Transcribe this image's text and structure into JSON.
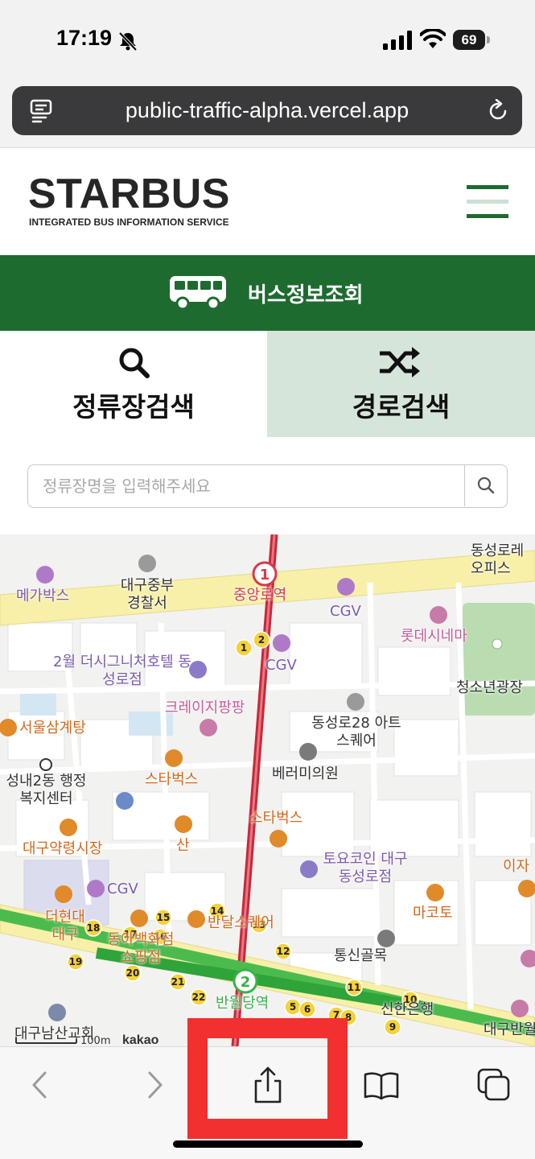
{
  "status_bar": {
    "time": "17:19",
    "battery": "69"
  },
  "browser": {
    "url": "public-traffic-alpha.vercel.app"
  },
  "site": {
    "logo": "STARBUS",
    "logo_subtitle": "INTEGRATED BUS INFORMATION SERVICE",
    "banner_title": "버스정보조회",
    "brand_color": "#1e6b30",
    "tabs": [
      {
        "label": "정류장검색",
        "icon": "search-icon",
        "selected": true
      },
      {
        "label": "경로검색",
        "icon": "shuffle-icon",
        "selected": false
      }
    ],
    "search": {
      "placeholder": "정류장명을 입력해주세요",
      "value": ""
    }
  },
  "map": {
    "labels": {
      "mega": "메가박스",
      "police": "대구중부 경찰서",
      "jungangro": "중앙로역",
      "cgv1": "CGV",
      "cgv2": "CGV",
      "cgv3": "CGV",
      "lotte": "롯데시네마",
      "dongseong_office": "동성로레 오피스",
      "hotel": "2월 더시그니처호텔 동성로점",
      "crazy": "크레이지팡팡",
      "youth_square": "청소년광장",
      "samgyetang": "서울삼계탕",
      "art_square": "동성로28 아트 스퀘어",
      "seongnae": "성내2동 행정복지센터",
      "starbucks1": "스타벅스",
      "clinic": "베러미의원",
      "starbucks2": "스타벅스",
      "san": "산",
      "medicine_market": "대구약령시장",
      "toyoko": "토요코인 대구동성로점",
      "hyundai": "더현대 대구",
      "dongah": "동아백화점 쇼핑점",
      "bandal": "반달스퀘어",
      "makoto": "마코토",
      "izakaya": "이자",
      "tongsin": "통신골목",
      "banwoldang": "반월당역",
      "shinhan": "신한은행",
      "namsan_church": "대구남산교회",
      "banwol_right": "대구반월",
      "kakao": "kakao",
      "scale": "100m"
    },
    "subway_stops": [
      "1",
      "2"
    ],
    "bus_stops": [
      "1",
      "2",
      "5",
      "6",
      "7",
      "8",
      "9",
      "10",
      "11",
      "12",
      "13",
      "14",
      "15",
      "16",
      "17",
      "18",
      "19",
      "20",
      "21",
      "22"
    ]
  },
  "toolbar": {
    "buttons": [
      "back-icon",
      "forward-icon",
      "share-icon",
      "bookmarks-icon",
      "tabs-icon"
    ],
    "highlighted": "share-icon",
    "highlight_color": "#f2302f"
  }
}
